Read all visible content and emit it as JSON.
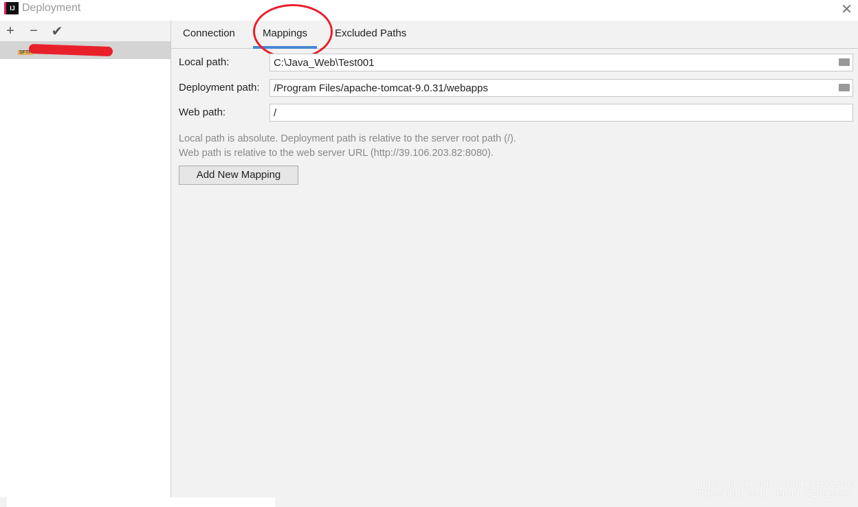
{
  "window": {
    "title": "Deployment",
    "icon_text": "IJ",
    "close": "✕"
  },
  "toolbar": {
    "add": "+",
    "remove": "−",
    "apply": "✔"
  },
  "server": {
    "badge": "SFTP"
  },
  "tabs": [
    {
      "label": "Connection"
    },
    {
      "label": "Mappings",
      "active": true
    },
    {
      "label": "Excluded Paths"
    }
  ],
  "form": {
    "local_label": "Local path:",
    "local_value": "C:\\Java_Web\\Test001",
    "deploy_label": "Deployment path:",
    "deploy_value": "/Program Files/apache-tomcat-9.0.31/webapps",
    "web_label": "Web path:",
    "web_value": "/"
  },
  "hints": [
    "Local path is absolute. Deployment path is relative to the server root path (/).",
    "Web path is relative to the web server URL (http://39.106.203.82:8080)."
  ],
  "add_button": "Add New Mapping",
  "watermark": "https://blog.csdn.net/qq_41092499",
  "colors": {
    "accent": "#4a88d0",
    "annotation": "#e8202a"
  }
}
